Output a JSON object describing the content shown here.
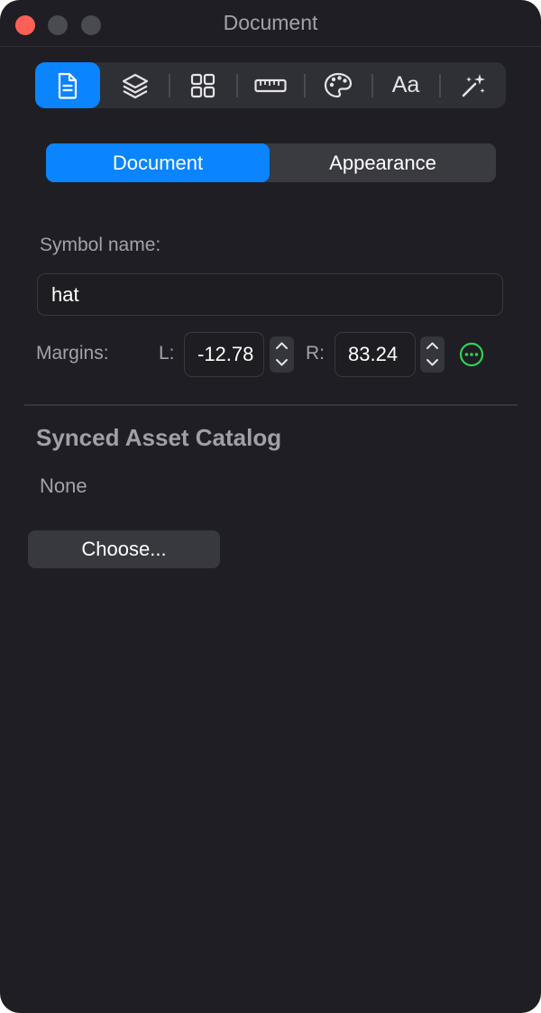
{
  "window": {
    "title": "Document"
  },
  "toolbar": {
    "tabs": [
      {
        "icon": "document-icon",
        "active": true
      },
      {
        "icon": "layers-icon",
        "active": false
      },
      {
        "icon": "grid-icon",
        "active": false
      },
      {
        "icon": "ruler-icon",
        "active": false
      },
      {
        "icon": "palette-icon",
        "active": false
      },
      {
        "icon": "typography-icon",
        "label": "Aa",
        "active": false
      },
      {
        "icon": "magic-wand-icon",
        "active": false
      }
    ]
  },
  "segmented": {
    "options": [
      "Document",
      "Appearance"
    ],
    "selected": "Document"
  },
  "symbol": {
    "label": "Symbol name:",
    "value": "hat"
  },
  "margins": {
    "label": "Margins:",
    "left_label": "L:",
    "left_value": "-12.78",
    "right_label": "R:",
    "right_value": "83.24"
  },
  "asset_catalog": {
    "title": "Synced Asset Catalog",
    "value": "None",
    "button_label": "Choose..."
  },
  "colors": {
    "accent": "#0a84ff",
    "background": "#1e1e24",
    "more_icon": "#30d158"
  }
}
